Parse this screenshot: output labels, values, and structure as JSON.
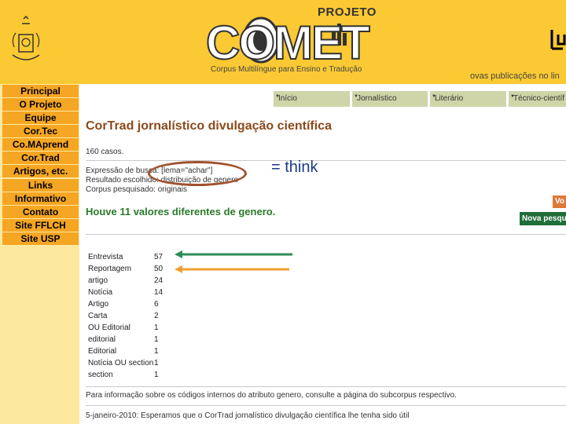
{
  "header": {
    "projeto": "PROJETO",
    "logo_word": "COMET",
    "tagline": "Corpus Multilíngue para Ensino e Tradução",
    "news_fragment": "ovas publicações no lin"
  },
  "nav": {
    "items": [
      "Principal",
      "O Projeto",
      "Equipe",
      "Cor.Tec",
      "Co.MAprend",
      "Cor.Trad",
      "Artigos, etc.",
      "Links",
      "Informativo",
      "Contato",
      "Site FFLCH",
      "Site USP"
    ]
  },
  "tabs": [
    "Início",
    "Jornalístico",
    "Literário",
    "Técnico-científ"
  ],
  "main": {
    "title": "CorTrad jornalístico divulgação científica",
    "cases": "160 casos.",
    "query_line": "Expressão de busca: [lema=\"achar\"]",
    "result_line": "Resultado escolhido: distribuição de genero",
    "corpus_line": "Corpus pesquisado: originais",
    "think": "= think",
    "summary": "Houve 11 valores diferentes de genero.",
    "vo_button": "Vo",
    "nova_button": "Nova pesqu",
    "rows": [
      {
        "label": "Entrevista",
        "count": "57"
      },
      {
        "label": "Reportagem",
        "count": "50"
      },
      {
        "label": "artigo",
        "count": "24"
      },
      {
        "label": "Notícia",
        "count": "14"
      },
      {
        "label": "Artigo",
        "count": "6"
      },
      {
        "label": "Carta",
        "count": "2"
      },
      {
        "label": "OU Editorial",
        "count": "1"
      },
      {
        "label": "editorial",
        "count": "1"
      },
      {
        "label": "Editorial",
        "count": "1"
      },
      {
        "label": "Notícia OU section",
        "count": "1"
      },
      {
        "label": "section",
        "count": "1"
      }
    ],
    "footer_info": "Para informação sobre os códigos internos do atributo genero, consulte a página do subcorpus respectivo.",
    "footer_date": "5-janeiro-2010: Esperamos que o CorTrad jornalístico divulgação científica lhe tenha sido útil"
  },
  "colors": {
    "header_bg": "#fbc933",
    "nav_item": "#f5a623",
    "title": "#8b4a1a",
    "green": "#2a7a2a",
    "green_arrow": "#2e8b57",
    "orange_arrow": "#f0a030",
    "oval": "#a0522d"
  }
}
